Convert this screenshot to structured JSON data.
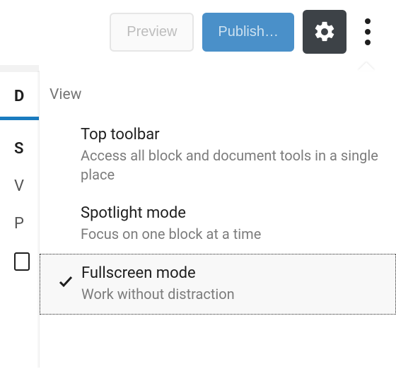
{
  "toolbar": {
    "preview_label": "Preview",
    "publish_label": "Publish…"
  },
  "popover": {
    "section_label": "View",
    "items": [
      {
        "title": "Top toolbar",
        "desc": "Access all block and document tools in a single place",
        "selected": false
      },
      {
        "title": "Spotlight mode",
        "desc": "Focus on one block at a time",
        "selected": false
      },
      {
        "title": "Fullscreen mode",
        "desc": "Work without distraction",
        "selected": true
      }
    ]
  },
  "sidebar": {
    "tab_initial": "D",
    "rows": [
      "S",
      "V",
      "P"
    ]
  }
}
